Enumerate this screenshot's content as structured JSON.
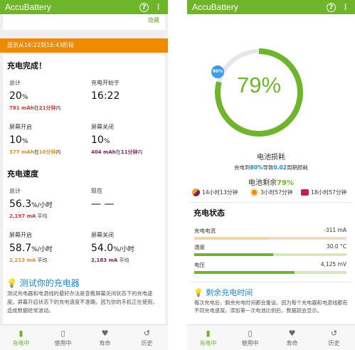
{
  "left": {
    "app_title": "AccuBattery",
    "hide_label": "隐藏",
    "orange_banner": "显示从16:22到16:43阶段",
    "charge_done_title": "充电完成！",
    "total": {
      "label": "总计",
      "value": "20",
      "unit": "%",
      "sub_value": "781 mAh",
      "sub_mid": "在",
      "sub_time": "21分钟",
      "sub_end": "内"
    },
    "started": {
      "label": "充电开始于",
      "value": "16:22"
    },
    "screen_on": {
      "label": "屏幕开启",
      "value": "10",
      "unit": "%",
      "sub_value": "377 mAh",
      "sub_mid": "在",
      "sub_time": "10分钟",
      "sub_end": "内"
    },
    "screen_off": {
      "label": "屏幕关闭",
      "value": "10",
      "unit": "%",
      "sub_value": "404 mAh",
      "sub_mid": "在",
      "sub_time": "11分钟",
      "sub_end": "内"
    },
    "speed_title": "充电速度",
    "speed_total": {
      "label": "总计",
      "value": "56.3",
      "unit": "%/小时",
      "sub_value": "2,197 mA",
      "sub_end": "平均"
    },
    "speed_now": {
      "label": "现在",
      "value": "— —"
    },
    "speed_on": {
      "label": "屏幕开启",
      "value": "58.7",
      "unit": "%/小时",
      "sub_value": "2,213 mA",
      "sub_end": "平均"
    },
    "speed_off": {
      "label": "屏幕关闭",
      "value": "54.0",
      "unit": "%/小时",
      "sub_value": "2,183 mA",
      "sub_end": "平均"
    },
    "test_title": "测试你的充电器",
    "test_text": "测试充电器和电源线的最好办法是查看屏幕关闭状态下的充电速度。屏幕开启状态下的充电速度不准确，因为你的手机正在使用，造成数据经常波动。"
  },
  "right": {
    "app_title": "AccuBattery",
    "percent": "79%",
    "marker_label": "80%",
    "ring_fill_percent": 79,
    "loss_title": "电池损耗",
    "loss_pre": "充电到",
    "loss_target": "80%",
    "loss_mid": "导致",
    "loss_value": "0.02",
    "loss_end": "周期损耗",
    "remain_pre": "电池剩余",
    "remain_value": "79%",
    "eta1": "14小时13分钟",
    "eta2": "3小时57分钟",
    "eta3": "18小时57分钟",
    "status_title": "充电状态",
    "current_label": "充电电流",
    "current_value": "-311 mA",
    "temp_label": "温度",
    "temp_value": "30.0 °C",
    "volt_label": "电压",
    "volt_value": "4,125 mV",
    "current_fill": 0.48,
    "temp_fill": 0.52,
    "volt_fill": 0.66,
    "remain_title": "剩余充电时间",
    "remain_text": "每次充电后，剩余充电时间都会重设，因为每个充电器和电源线都有不同充电速度。添加第一次电池比例后，数据就会显示。"
  },
  "nav": [
    "充电中",
    "使用中",
    "寿命",
    "历史"
  ],
  "colors": {
    "green": "#6fb52c",
    "orange": "#f08b00",
    "blue": "#1e88c8",
    "red": "#d6382a",
    "purple": "#7b1f63"
  }
}
